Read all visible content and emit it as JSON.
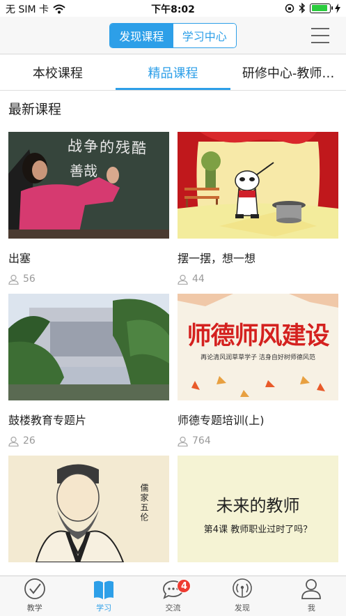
{
  "status_bar": {
    "carrier": "无 SIM 卡",
    "time": "下午8:02",
    "battery_level": 0.9
  },
  "header": {
    "segments": [
      {
        "label": "发现课程",
        "active": true
      },
      {
        "label": "学习中心",
        "active": false
      }
    ]
  },
  "tabs": [
    {
      "label": "本校课程",
      "active": false
    },
    {
      "label": "精品课程",
      "active": true
    },
    {
      "label": "研修中心-教师…",
      "active": false
    }
  ],
  "section_title": "最新课程",
  "courses": [
    {
      "title": "出塞",
      "learners": "56"
    },
    {
      "title": "摆一摆，想一想",
      "learners": "44"
    },
    {
      "title": "鼓楼教育专题片",
      "learners": "26"
    },
    {
      "title": "师德专题培训(上)",
      "learners": "764"
    },
    {
      "title": "",
      "learners": ""
    },
    {
      "title": "",
      "learners": ""
    }
  ],
  "thumb_text": {
    "blackboard": "战争的残酷",
    "blackboard2": "善哉",
    "banner_title": "师德师风建设",
    "banner_sub": "再论清风润草草学子 洁身自好树师德风范",
    "sage_caption": "儒家五伦",
    "future_title": "未来的教师",
    "future_sub": "第4课  教师职业过时了吗？"
  },
  "tabbar": {
    "items": [
      {
        "label": "教学",
        "icon": "check-circle-icon"
      },
      {
        "label": "学习",
        "icon": "book-icon",
        "active": true
      },
      {
        "label": "交流",
        "icon": "chat-icon",
        "badge": "4"
      },
      {
        "label": "发现",
        "icon": "broadcast-icon"
      },
      {
        "label": "我",
        "icon": "person-icon"
      }
    ]
  },
  "colors": {
    "accent": "#2d9fe8",
    "badge": "#ee3b31"
  }
}
